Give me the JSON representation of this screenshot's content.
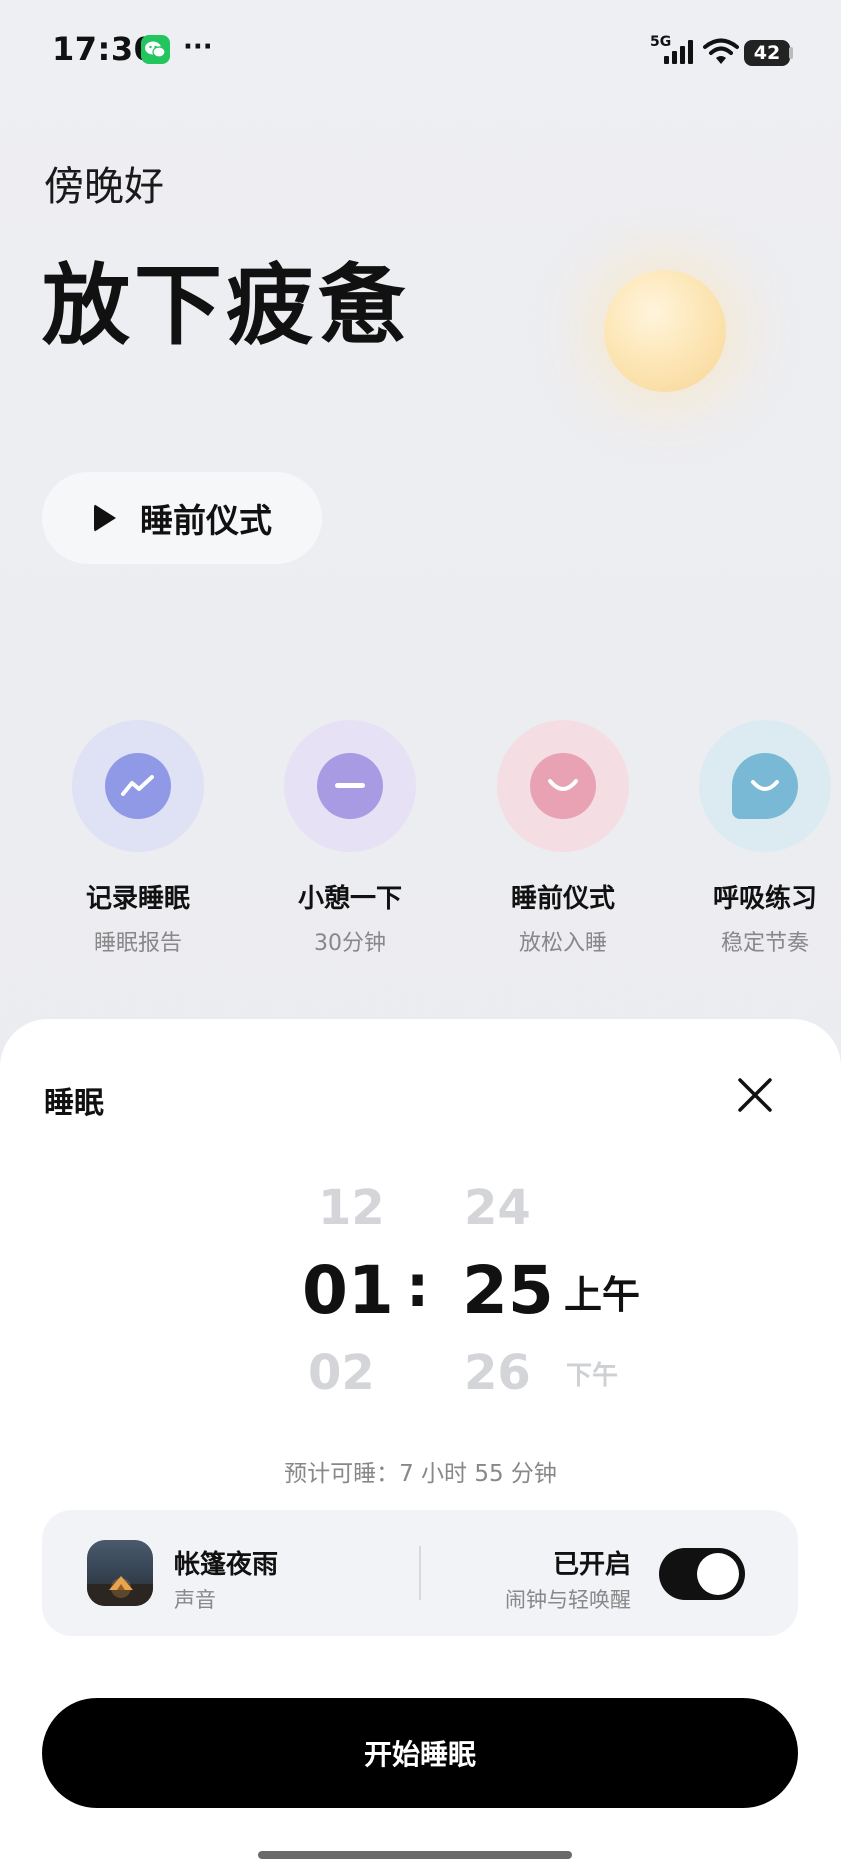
{
  "status_bar": {
    "time": "17:30",
    "more": "···",
    "network": "5G",
    "battery": "42",
    "icons": [
      "wechat-icon",
      "signal-icon",
      "wifi-icon",
      "battery-icon"
    ]
  },
  "hero": {
    "greeting": "傍晚好",
    "headline": "放下疲惫",
    "ritual_button": "睡前仪式"
  },
  "shortcuts": [
    {
      "title": "记录睡眠",
      "subtitle": "睡眠报告",
      "icon": "trend-icon",
      "halo": "#dfe1f5",
      "color": "#8f99e6"
    },
    {
      "title": "小憩一下",
      "subtitle": "30分钟",
      "icon": "minus-icon",
      "halo": "#e6e1f4",
      "color": "#a89be3"
    },
    {
      "title": "睡前仪式",
      "subtitle": "放松入睡",
      "icon": "smile-icon",
      "halo": "#f4dde3",
      "color": "#e8a2b4"
    },
    {
      "title": "呼吸练习",
      "subtitle": "稳定节奏",
      "icon": "chat-smile-icon",
      "halo": "#dcebf2",
      "color": "#7ab9d6"
    }
  ],
  "sheet": {
    "title": "睡眠",
    "time_picker": {
      "hours": {
        "prev": "12",
        "current": "01",
        "next": "02"
      },
      "separator": ":",
      "minutes": {
        "prev": "24",
        "current": "25",
        "next": "26"
      },
      "period": {
        "current": "上午",
        "next": "下午"
      }
    },
    "estimate": "预计可睡：7 小时 55 分钟",
    "sound": {
      "name": "帐篷夜雨",
      "label": "声音"
    },
    "alarm": {
      "state": "已开启",
      "label": "闹钟与轻唤醒",
      "enabled": true
    },
    "start_button": "开始睡眠"
  }
}
